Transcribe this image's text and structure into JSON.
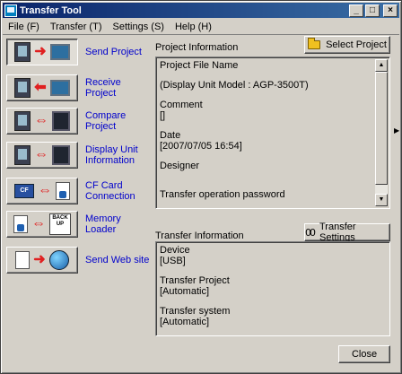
{
  "window": {
    "title": "Transfer Tool"
  },
  "title_controls": {
    "minimize": "_",
    "maximize": "□",
    "close": "×"
  },
  "menu": [
    "File (F)",
    "Transfer (T)",
    "Settings (S)",
    "Help (H)"
  ],
  "operations": [
    {
      "label": "Send Project",
      "icons": [
        "pc-icon",
        "right-arrow-icon",
        "display-unit-icon"
      ]
    },
    {
      "label": "Receive Project",
      "icons": [
        "pc-icon",
        "left-arrow-icon",
        "display-unit-icon"
      ]
    },
    {
      "label": "Compare Project",
      "icons": [
        "pc-icon",
        "double-arrow-icon",
        "display-unit-icon"
      ]
    },
    {
      "label": "Display Unit Information",
      "icons": [
        "pc-icon",
        "double-arrow-icon",
        "display-unit-icon"
      ]
    },
    {
      "label": "CF Card Connection",
      "icons": [
        "cf-card-icon",
        "double-arrow-icon",
        "document-icon"
      ]
    },
    {
      "label": "Memory Loader",
      "icons": [
        "document-icon",
        "double-arrow-icon",
        "backup-icon"
      ]
    },
    {
      "label": "Send Web site",
      "icons": [
        "documents-icon",
        "right-arrow-icon",
        "globe-icon"
      ]
    }
  ],
  "icon_text": {
    "cf": "CF",
    "backup": "BACK UP",
    "arrow_right": "➜",
    "arrow_left": "⬅",
    "arrow_both": "⇔",
    "scroll_up": "▲",
    "scroll_down": "▼",
    "side_arrow": "▶"
  },
  "project_info": {
    "label": "Project Information",
    "select_button": "Select Project",
    "lines": [
      "Project File Name",
      "",
      "(Display Unit Model : AGP-3500T)",
      "",
      "Comment",
      "[]",
      "",
      "Date",
      "[2007/07/05 16:54]",
      "",
      "Designer",
      "",
      "",
      "Transfer operation password"
    ]
  },
  "transfer_info": {
    "label": "Transfer Information",
    "settings_button": "Transfer Settings",
    "lines": [
      "Device",
      "[USB]",
      "",
      "Transfer Project",
      "[Automatic]",
      "",
      "Transfer system",
      "[Automatic]"
    ]
  },
  "close_button": "Close",
  "colors": {
    "title_start": "#0a246a",
    "title_end": "#3a6ea5",
    "link": "#0000cc",
    "arrow": "#e02020"
  }
}
